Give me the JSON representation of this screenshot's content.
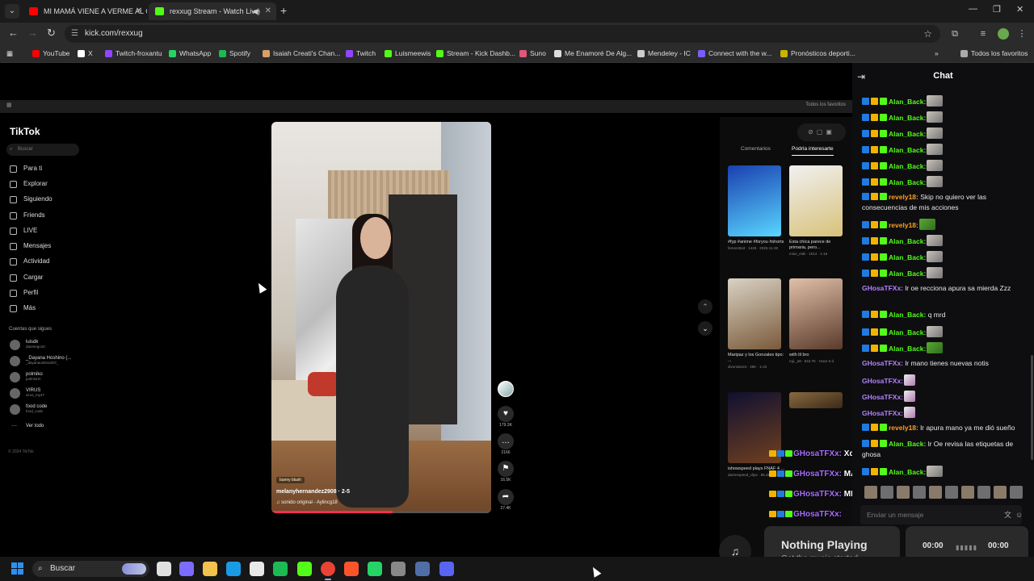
{
  "browser": {
    "tabs": [
      {
        "title": "MI MAMÁ VIENE A VERME AL C",
        "favicon_color": "#ff0000"
      },
      {
        "title": "rexxug Stream - Watch Live",
        "favicon_color": "#53fc18"
      }
    ],
    "url": "kick.com/rexxug",
    "bookmarks": [
      {
        "label": "YouTube",
        "color": "#ff0000"
      },
      {
        "label": "X",
        "color": "#ffffff"
      },
      {
        "label": "Twitch-froxantu",
        "color": "#9146ff"
      },
      {
        "label": "WhatsApp",
        "color": "#25d366"
      },
      {
        "label": "Spotify",
        "color": "#1db954"
      },
      {
        "label": "Isaiah Creati's Chan...",
        "color": "#d9a066"
      },
      {
        "label": "Twitch",
        "color": "#9146ff"
      },
      {
        "label": "Luismeewis",
        "color": "#53fc18"
      },
      {
        "label": "Stream - Kick Dashb...",
        "color": "#53fc18"
      },
      {
        "label": "Suno",
        "color": "#e0577a"
      },
      {
        "label": "Me Enamoré De Alg...",
        "color": "#dddddd"
      },
      {
        "label": "Mendeley - IC",
        "color": "#cccccc"
      },
      {
        "label": "Connect with the w...",
        "color": "#7b5cff"
      },
      {
        "label": "Pronósticos deporti...",
        "color": "#c8b400"
      }
    ],
    "all_bookmarks": "Todos los favoritos"
  },
  "stream": {
    "inner_bookmarks": "Todos los favoritos",
    "tiktok": {
      "logo": "TikTok",
      "search_placeholder": "Buscar",
      "nav": [
        "Para ti",
        "Explorar",
        "Siguiendo",
        "Friends",
        "LIVE",
        "Mensajes",
        "Actividad",
        "Cargar",
        "Perfil",
        "Más"
      ],
      "following_title": "Cuentas que sigues",
      "accounts": [
        {
          "name": "luisdk",
          "handle": "danmego10"
        },
        {
          "name": "_Dayana Hoshino (...",
          "handle": "_dayanaoshino007_"
        },
        {
          "name": "polmiko",
          "handle": "polmiorm"
        },
        {
          "name": "VIRUS",
          "handle": "virus_my47"
        },
        {
          "name": "food code",
          "handle": "food_code"
        }
      ],
      "see_all": "Ver todo",
      "copyright": "© 2024 TikTok",
      "video": {
        "tag": "bunny blush",
        "username": "melanyhernandez2908 · 2-5",
        "sound": "♫ sonido original - Aylincg18",
        "progress": 0.55
      },
      "rail": [
        {
          "icon": "♥",
          "count": "179.3K"
        },
        {
          "icon": "…",
          "count": "2166"
        },
        {
          "icon": "⚑",
          "count": "16.5K"
        },
        {
          "icon": "➦",
          "count": "27.4K"
        }
      ],
      "panel_tabs": [
        "Comentarios",
        "Podría interesarte"
      ],
      "thumbs": [
        {
          "caption": "#fyp #anime #foryou #shorts",
          "meta": "femen3ta3 · 1428 · 2025-11-28",
          "color1": "#1a3fb0",
          "color2": "#59d6ff"
        },
        {
          "caption": "Esta chica parece de primaria, pero...",
          "meta": "mine_eski · 1014 · 1-16",
          "color1": "#f0f0f0",
          "color2": "#d8c27a"
        },
        {
          "caption": "Maripaz y los Gonzales tipo: ...",
          "meta": "divonstar24 · 49K · 1-22",
          "color1": "#d9d2c4",
          "color2": "#7a5a3a"
        },
        {
          "caption": "with lil bro",
          "meta": "ruji._a9 · 543.7K · Hace 6 d",
          "color1": "#e0c0a8",
          "color2": "#5a3a2a"
        },
        {
          "caption": "ishowspeed plays FNAF 4 ...",
          "meta": "darrenspeed_clips · 85.4K · 1-29",
          "color1": "#101030",
          "color2": "#704020"
        },
        {
          "caption": "",
          "meta": "",
          "color1": "#8a6a40",
          "color2": "#3a2a18"
        }
      ]
    },
    "overlay_msgs": [
      {
        "name": "GHosaTFXx:",
        "text": "Xd"
      },
      {
        "name": "GHosaTFXx:",
        "text": "MANO"
      },
      {
        "name": "GHosaTFXx:",
        "text": "MIRA"
      },
      {
        "name": "GHosaTFXx:",
        "text": ""
      }
    ]
  },
  "chat": {
    "title": "Chat",
    "input_placeholder": "Enviar un mensaje",
    "messages": [
      {
        "user": "Alan_Back:",
        "color": "green",
        "text": "",
        "emote": "gray",
        "badges": true
      },
      {
        "user": "Alan_Back:",
        "color": "green",
        "text": "",
        "emote": "gray",
        "badges": true
      },
      {
        "user": "Alan_Back:",
        "color": "green",
        "text": "",
        "emote": "gray",
        "badges": true
      },
      {
        "user": "Alan_Back:",
        "color": "green",
        "text": "",
        "emote": "gray",
        "badges": true
      },
      {
        "user": "Alan_Back:",
        "color": "green",
        "text": "",
        "emote": "gray",
        "badges": true
      },
      {
        "user": "Alan_Back:",
        "color": "green",
        "text": "",
        "emote": "gray",
        "badges": true
      },
      {
        "user": "revely18:",
        "color": "orange",
        "text": "Skip no quiero ver las consecuencias de mis acciones",
        "emote": "",
        "badges": true
      },
      {
        "user": "revely18:",
        "color": "orange",
        "text": "",
        "emote": "frog",
        "badges": true
      },
      {
        "user": "Alan_Back:",
        "color": "green",
        "text": "",
        "emote": "gray",
        "badges": true
      },
      {
        "user": "Alan_Back:",
        "color": "green",
        "text": "",
        "emote": "gray",
        "badges": true
      },
      {
        "user": "Alan_Back:",
        "color": "green",
        "text": "",
        "emote": "gray",
        "badges": true
      },
      {
        "user": "GHosaTFXx:",
        "color": "purple",
        "text": "lr oe recciona apura sa mierda Zzz",
        "emote": "",
        "badges": false
      },
      {
        "user": "Alan_Back:",
        "color": "green",
        "text": "q mrd",
        "emote": "",
        "badges": true
      },
      {
        "user": "Alan_Back:",
        "color": "green",
        "text": "",
        "emote": "gray",
        "badges": true
      },
      {
        "user": "Alan_Back:",
        "color": "green",
        "text": "",
        "emote": "frog",
        "badges": true
      },
      {
        "user": "GHosaTFXx:",
        "color": "purple",
        "text": "lr mano tienes nuevas notis",
        "emote": "",
        "badges": false
      },
      {
        "user": "GHosaTFXx:",
        "color": "purple",
        "text": "",
        "emote": "cat",
        "badges": false
      },
      {
        "user": "GHosaTFXx:",
        "color": "purple",
        "text": "",
        "emote": "cat",
        "badges": false
      },
      {
        "user": "GHosaTFXx:",
        "color": "purple",
        "text": "",
        "emote": "cat",
        "badges": false
      },
      {
        "user": "revely18:",
        "color": "orange",
        "text": "lr apura mano ya me dió sueño",
        "emote": "",
        "badges": true
      },
      {
        "user": "Alan_Back:",
        "color": "green",
        "text": "lr Oe revisa las etiquetas de ghosa",
        "emote": "",
        "badges": true
      },
      {
        "user": "Alan_Back:",
        "color": "green",
        "text": "",
        "emote": "gray",
        "badges": true
      }
    ]
  },
  "music": {
    "title": "Nothing Playing",
    "subtitle": "Get the music started",
    "time_start": "00:00",
    "time_end": "00:00"
  },
  "taskbar": {
    "search_label": "Buscar",
    "apps": [
      {
        "name": "file-manager",
        "color": "#e0e0e0"
      },
      {
        "name": "copilot",
        "color": "#7b6cff"
      },
      {
        "name": "folder",
        "color": "#f2c14e"
      },
      {
        "name": "edge",
        "color": "#1a9be6"
      },
      {
        "name": "store",
        "color": "#e8e8e8"
      },
      {
        "name": "spotify",
        "color": "#1db954"
      },
      {
        "name": "kick",
        "color": "#53fc18"
      },
      {
        "name": "chrome",
        "color": "#ea4335"
      },
      {
        "name": "brave",
        "color": "#fb542b"
      },
      {
        "name": "whatsapp",
        "color": "#25d366"
      },
      {
        "name": "settings",
        "color": "#888888"
      },
      {
        "name": "app-unknown",
        "color": "#4f6ea8"
      },
      {
        "name": "discord",
        "color": "#5865f2"
      }
    ]
  }
}
